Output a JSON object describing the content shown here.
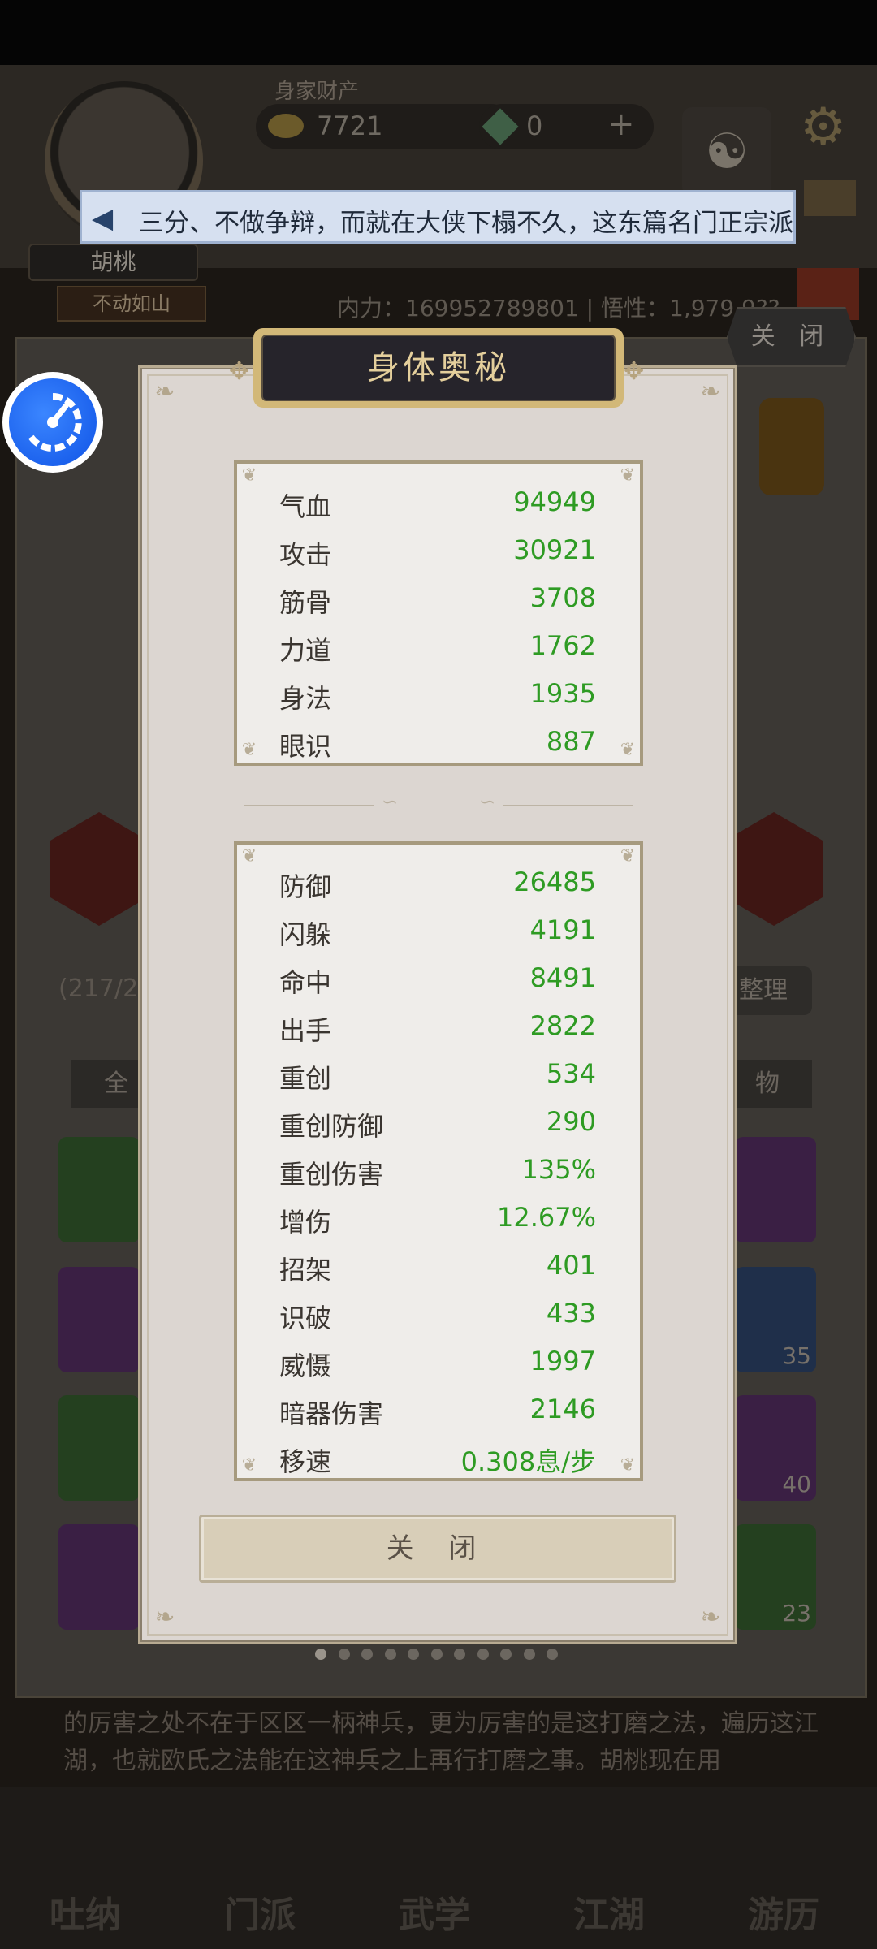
{
  "notice": {
    "text": "三分、不做争辩，而就在大侠下榻不久，这东篇名门正宗派"
  },
  "background": {
    "asset_label": "身家财产",
    "gold_value": "7721",
    "jade_value": "0",
    "plus": "+",
    "character_name": "胡桃",
    "character_title": "不动如山",
    "power_text": "内力：169952789801 | 悟性：1,979,9??",
    "top_close_label": "关 闭",
    "capacity_text": "(217/26",
    "sort_label": "整理",
    "filter_left": "全",
    "filter_right": "物",
    "slot_counts": [
      "35",
      "40",
      "23"
    ],
    "footer_text": "的厉害之处不在于区区一柄神兵，更为厉害的是这打磨之法，遍历这江湖，也就欧氏之法能在这神兵之上再行打磨之事。胡桃现在用",
    "nav": [
      "吐纳",
      "门派",
      "武学",
      "江湖",
      "游历"
    ]
  },
  "modal": {
    "title": "身体奥秘",
    "primary_stats": [
      {
        "label": "气血",
        "value": "94949"
      },
      {
        "label": "攻击",
        "value": "30921"
      },
      {
        "label": "筋骨",
        "value": "3708"
      },
      {
        "label": "力道",
        "value": "1762"
      },
      {
        "label": "身法",
        "value": "1935"
      },
      {
        "label": "眼识",
        "value": "887"
      }
    ],
    "secondary_stats": [
      {
        "label": "防御",
        "value": "26485"
      },
      {
        "label": "闪躲",
        "value": "4191"
      },
      {
        "label": "命中",
        "value": "8491"
      },
      {
        "label": "出手",
        "value": "2822"
      },
      {
        "label": "重创",
        "value": "534"
      },
      {
        "label": "重创防御",
        "value": "290"
      },
      {
        "label": "重创伤害",
        "value": "135%"
      },
      {
        "label": "增伤",
        "value": "12.67%"
      },
      {
        "label": "招架",
        "value": "401"
      },
      {
        "label": "识破",
        "value": "433"
      },
      {
        "label": "威慑",
        "value": "1997"
      },
      {
        "label": "暗器伤害",
        "value": "2146"
      },
      {
        "label": "移速",
        "value": "0.308息/步"
      }
    ],
    "close_label": "关 闭"
  },
  "pager": {
    "count": 11,
    "active": 0
  },
  "colors": {
    "stat_value": "#2e9b23",
    "title_text": "#e4cf9c",
    "notice_bg": "#d6e0f0",
    "speed_button": "#1a63f0"
  },
  "icons": [
    "speaker-icon",
    "speed-gauge-icon",
    "gear-icon",
    "mail-icon",
    "yin-yang-icon",
    "gold-ingot-icon",
    "jade-icon"
  ]
}
